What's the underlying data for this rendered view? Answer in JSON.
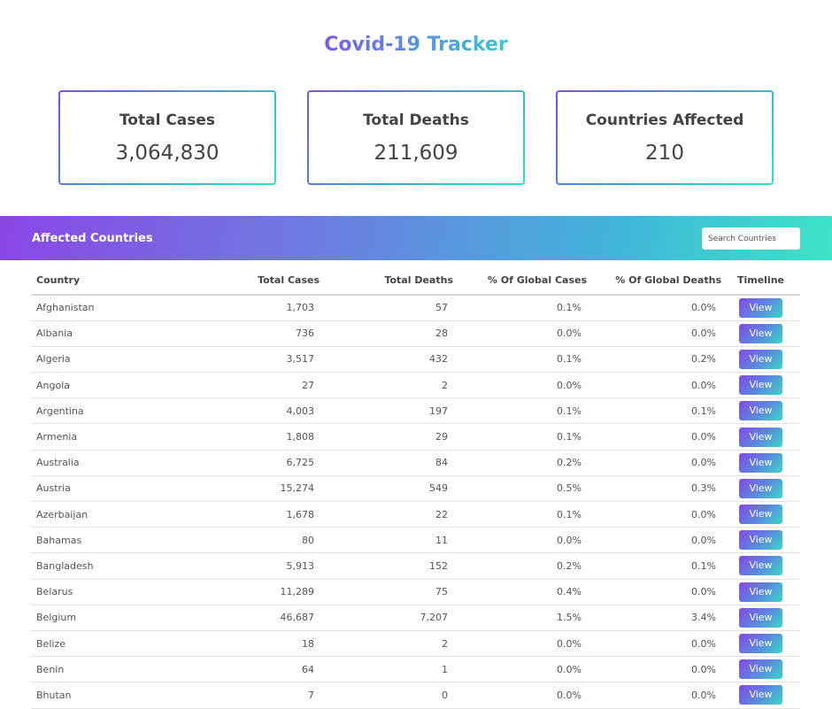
{
  "header": {
    "title": "Covid-19 Tracker"
  },
  "stats": [
    {
      "label": "Total Cases",
      "value": "3,064,830"
    },
    {
      "label": "Total Deaths",
      "value": "211,609"
    },
    {
      "label": "Countries Affected",
      "value": "210"
    }
  ],
  "section": {
    "title": "Affected Countries",
    "search_placeholder": "Search Countries"
  },
  "table": {
    "columns": [
      "Country",
      "Total Cases",
      "Total Deaths",
      "% Of Global Cases",
      "% Of Global Deaths",
      "Timeline"
    ],
    "view_label": "View",
    "rows": [
      [
        "Afghanistan",
        "1,703",
        "57",
        "0.1%",
        "0.0%"
      ],
      [
        "Albania",
        "736",
        "28",
        "0.0%",
        "0.0%"
      ],
      [
        "Algeria",
        "3,517",
        "432",
        "0.1%",
        "0.2%"
      ],
      [
        "Angola",
        "27",
        "2",
        "0.0%",
        "0.0%"
      ],
      [
        "Argentina",
        "4,003",
        "197",
        "0.1%",
        "0.1%"
      ],
      [
        "Armenia",
        "1,808",
        "29",
        "0.1%",
        "0.0%"
      ],
      [
        "Australia",
        "6,725",
        "84",
        "0.2%",
        "0.0%"
      ],
      [
        "Austria",
        "15,274",
        "549",
        "0.5%",
        "0.3%"
      ],
      [
        "Azerbaijan",
        "1,678",
        "22",
        "0.1%",
        "0.0%"
      ],
      [
        "Bahamas",
        "80",
        "11",
        "0.0%",
        "0.0%"
      ],
      [
        "Bangladesh",
        "5,913",
        "152",
        "0.2%",
        "0.1%"
      ],
      [
        "Belarus",
        "11,289",
        "75",
        "0.4%",
        "0.0%"
      ],
      [
        "Belgium",
        "46,687",
        "7,207",
        "1.5%",
        "3.4%"
      ],
      [
        "Belize",
        "18",
        "2",
        "0.0%",
        "0.0%"
      ],
      [
        "Benin",
        "64",
        "1",
        "0.0%",
        "0.0%"
      ],
      [
        "Bhutan",
        "7",
        "0",
        "0.0%",
        "0.0%"
      ]
    ]
  },
  "colors": {
    "gradient_start": "#8a46e6",
    "gradient_mid": "#5b86df",
    "gradient_end": "#3ee3c6"
  }
}
